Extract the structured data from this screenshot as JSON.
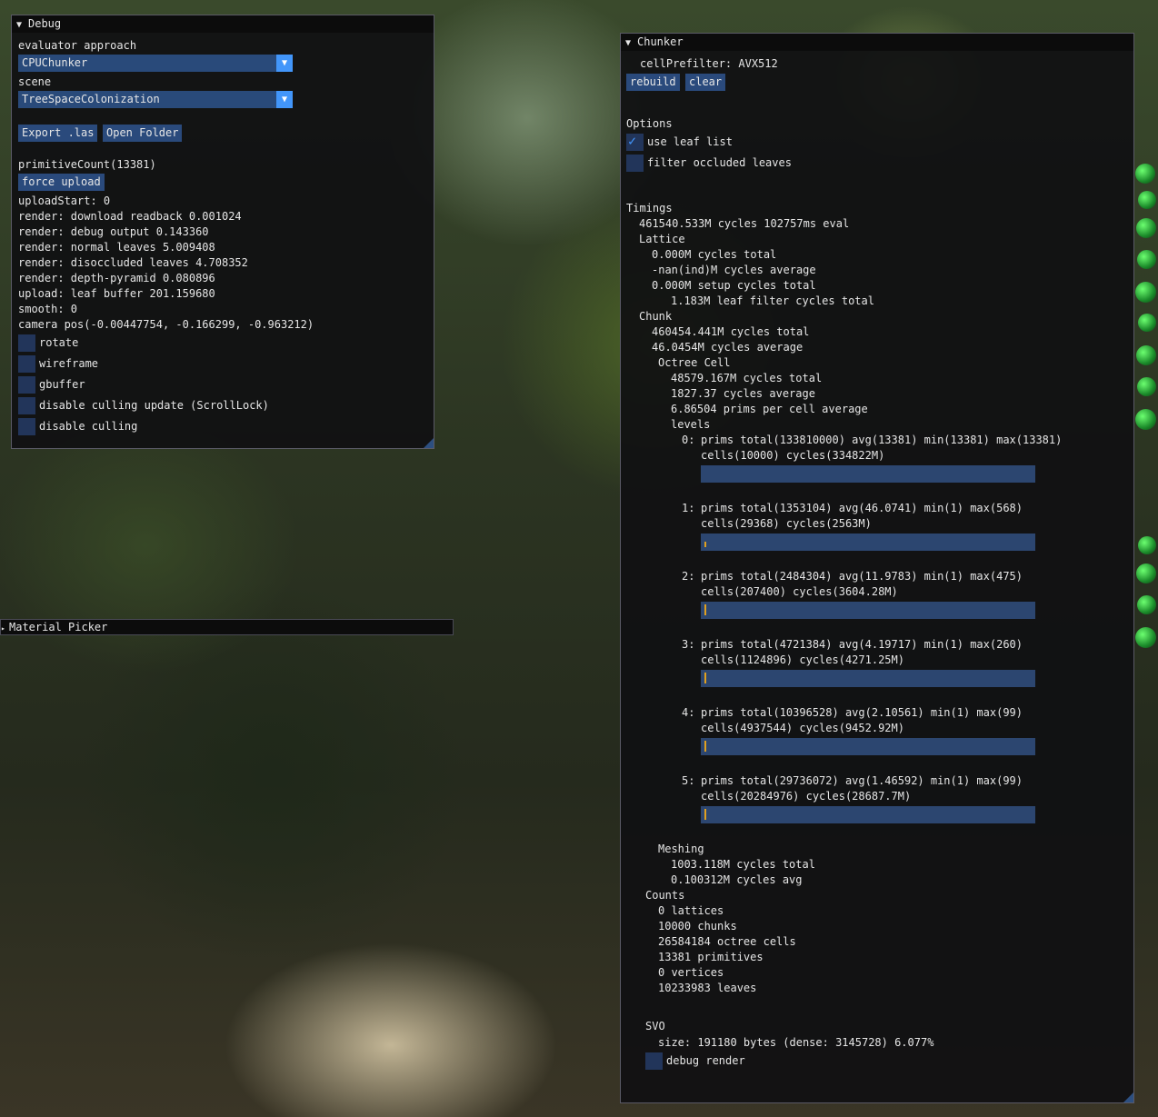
{
  "debug": {
    "title": "Debug",
    "evaluator_label": "evaluator approach",
    "evaluator_value": "CPUChunker",
    "scene_label": "scene",
    "scene_value": "TreeSpaceColonization",
    "export_button": "Export .las",
    "open_folder_button": "Open Folder",
    "primitive_count": "primitiveCount(13381)",
    "force_upload_button": "force upload",
    "stats": [
      "uploadStart: 0",
      "render: download readback 0.001024",
      "render: debug output 0.143360",
      "render: normal leaves 5.009408",
      "render: disoccluded leaves 4.708352",
      "render: depth-pyramid 0.080896",
      "upload: leaf buffer 201.159680",
      "smooth: 0",
      "camera pos(-0.00447754, -0.166299, -0.963212)"
    ],
    "checkboxes": [
      {
        "label": "rotate",
        "checked": false
      },
      {
        "label": "wireframe",
        "checked": false
      },
      {
        "label": "gbuffer",
        "checked": false
      },
      {
        "label": "disable culling update (ScrollLock)",
        "checked": false
      },
      {
        "label": "disable culling",
        "checked": false
      }
    ]
  },
  "material_picker": {
    "title": "Material Picker"
  },
  "chunker": {
    "title": "Chunker",
    "cell_prefilter": "cellPrefilter: AVX512",
    "rebuild_button": "rebuild",
    "clear_button": "clear",
    "options_header": "Options",
    "use_leaf_list": {
      "label": "use leaf list",
      "checked": true
    },
    "filter_occluded": {
      "label": "filter occluded leaves",
      "checked": false
    },
    "timings_header": "Timings",
    "eval_line": "461540.533M cycles 102757ms eval",
    "lattice_header": "Lattice",
    "lattice_lines": [
      "0.000M cycles total",
      "-nan(ind)M cycles average",
      "0.000M setup cycles total",
      "1.183M leaf filter cycles total"
    ],
    "chunk_header": "Chunk",
    "chunk_lines": [
      "460454.441M cycles total",
      "46.0454M cycles average"
    ],
    "octree_header": "Octree Cell",
    "octree_lines": [
      "48579.167M cycles total",
      "1827.37 cycles average",
      "6.86504 prims per cell average"
    ],
    "levels_header": "levels",
    "levels": [
      {
        "index": "0:",
        "line1": "prims total(133810000) avg(13381) min(13381) max(13381)",
        "line2": "cells(10000) cycles(334822M)",
        "marker": 0.0
      },
      {
        "index": "1:",
        "line1": "prims total(1353104) avg(46.0741) min(1) max(568)",
        "line2": "cells(29368) cycles(2563M)",
        "marker": 0.01
      },
      {
        "index": "2:",
        "line1": "prims total(2484304) avg(11.9783) min(1) max(475)",
        "line2": "cells(207400) cycles(3604.28M)",
        "marker": 0.01
      },
      {
        "index": "3:",
        "line1": "prims total(4721384) avg(4.19717) min(1) max(260)",
        "line2": "cells(1124896) cycles(4271.25M)",
        "marker": 0.01
      },
      {
        "index": "4:",
        "line1": "prims total(10396528) avg(2.10561) min(1) max(99)",
        "line2": "cells(4937544) cycles(9452.92M)",
        "marker": 0.01
      },
      {
        "index": "5:",
        "line1": "prims total(29736072) avg(1.46592) min(1) max(99)",
        "line2": "cells(20284976) cycles(28687.7M)",
        "marker": 0.01
      }
    ],
    "meshing_header": "Meshing",
    "meshing_lines": [
      "1003.118M cycles total",
      "0.100312M cycles avg"
    ],
    "counts_header": "Counts",
    "counts_lines": [
      "0 lattices",
      "10000 chunks",
      "26584184 octree cells",
      "13381 primitives",
      "0 vertices",
      "10233983 leaves"
    ],
    "svo_header": "SVO",
    "svo_size": "size: 191180 bytes (dense: 3145728) 6.077%",
    "debug_render": {
      "label": "debug render",
      "checked": false
    }
  },
  "colors": {
    "window_bg": "#101012",
    "title_bg": "#0c0c0c",
    "frame_bg": "#22355a",
    "button": "#2a4a7c",
    "accent": "#4296fa",
    "histogram_tick": "#e0a020"
  }
}
